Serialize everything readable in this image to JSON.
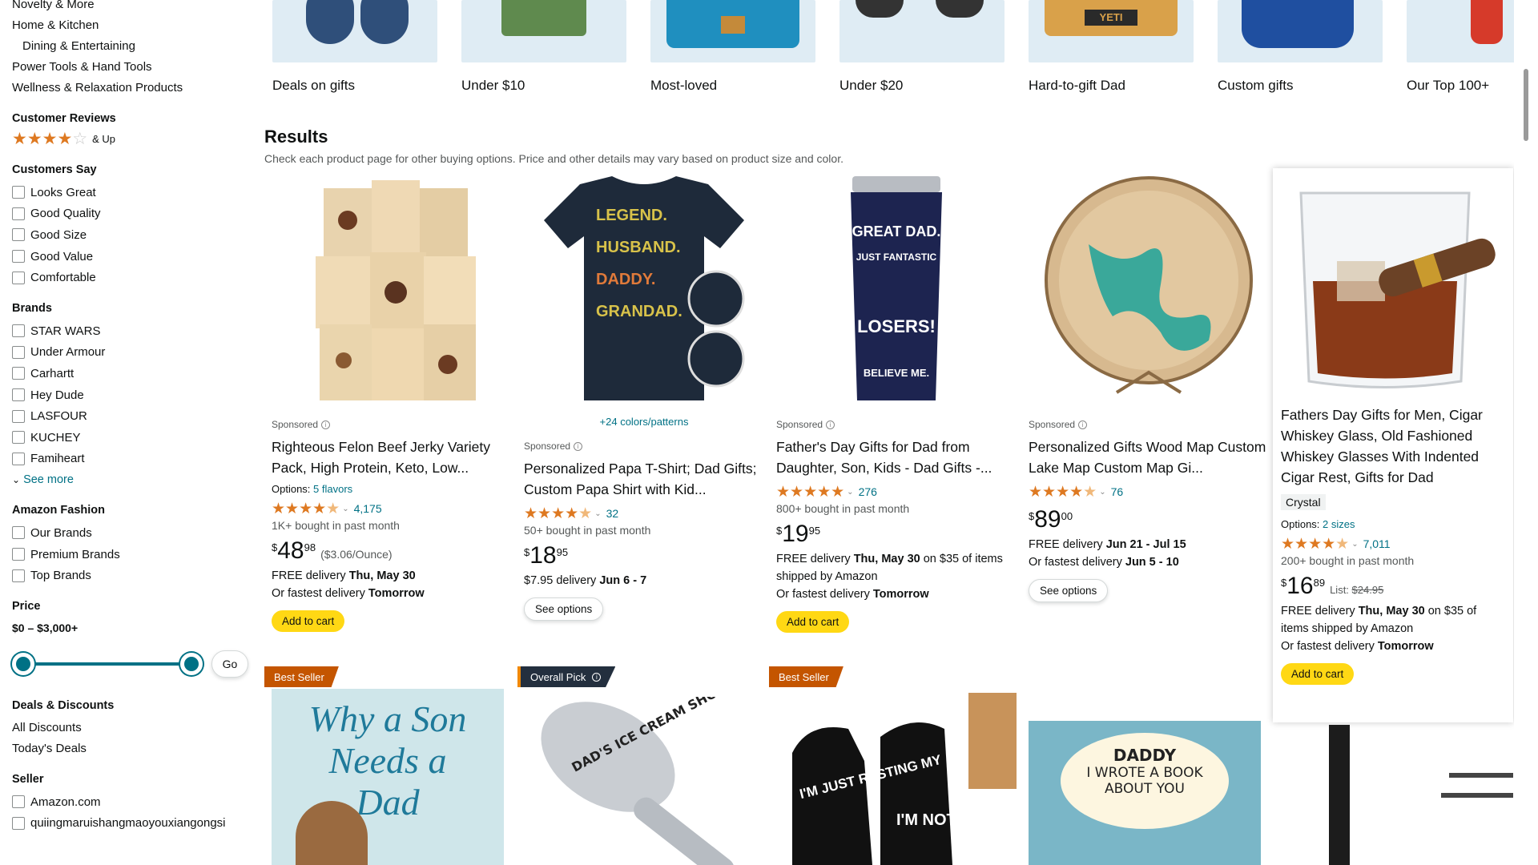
{
  "sidebar": {
    "top_links": [
      "Novelty & More",
      "Home & Kitchen",
      "Dining & Entertaining",
      "Power Tools & Hand Tools",
      "Wellness & Relaxation Products"
    ],
    "customer_reviews": {
      "heading": "Customer Reviews",
      "rating": 4,
      "label": "& Up"
    },
    "customers_say": {
      "heading": "Customers Say",
      "items": [
        "Looks Great",
        "Good Quality",
        "Good Size",
        "Good Value",
        "Comfortable"
      ]
    },
    "brands": {
      "heading": "Brands",
      "items": [
        "STAR WARS",
        "Under Armour",
        "Carhartt",
        "Hey Dude",
        "LASFOUR",
        "KUCHEY",
        "Famiheart"
      ],
      "see_more": "See more"
    },
    "amazon_fashion": {
      "heading": "Amazon Fashion",
      "items": [
        "Our Brands",
        "Premium Brands",
        "Top Brands"
      ]
    },
    "price": {
      "heading": "Price",
      "range": "$0 – $3,000+",
      "go": "Go"
    },
    "deals": {
      "heading": "Deals & Discounts",
      "items": [
        "All Discounts",
        "Today's Deals"
      ]
    },
    "seller": {
      "heading": "Seller",
      "items": [
        "Amazon.com",
        "quiingmaruishangmaoyouxiangongsi"
      ]
    }
  },
  "categories": [
    {
      "label": "Deals on gifts",
      "color": "#dfecf4",
      "thing": "#2f4f7a"
    },
    {
      "label": "Under $10",
      "color": "#dfecf4",
      "thing": "#5f8a4e"
    },
    {
      "label": "Most-loved",
      "color": "#dfecf4",
      "thing": "#1f8fbf"
    },
    {
      "label": "Under $20",
      "color": "#dfecf4",
      "thing": "#333333"
    },
    {
      "label": "Hard-to-gift Dad",
      "color": "#dfecf4",
      "thing": "#d9a14a"
    },
    {
      "label": "Custom gifts",
      "color": "#dfecf4",
      "thing": "#1f4fa0"
    },
    {
      "label": "Our Top 100+",
      "color": "#dfecf4",
      "thing": "#d63a2a"
    }
  ],
  "results": {
    "heading": "Results",
    "subtext": "Check each product page for other buying options. Price and other details may vary based on product size and color."
  },
  "products": [
    {
      "sponsored": "Sponsored",
      "title": "Righteous Felon Beef Jerky Variety Pack, High Protein, Keto, Low...",
      "options_label": "Options:",
      "options_link": "5 flavors",
      "rating": 4.5,
      "reviews": "4,175",
      "bought": "1K+ bought in past month",
      "price_sym": "$",
      "price_whole": "48",
      "price_frac": "98",
      "unit_price": "($3.06/Ounce)",
      "delivery_1_pre": "FREE delivery ",
      "delivery_1_date": "Thu, May 30",
      "delivery_1_post": "",
      "delivery_2_pre": "Or fastest delivery ",
      "delivery_2_date": "Tomorrow",
      "button": "Add to cart"
    },
    {
      "colors": "+24 colors/patterns",
      "sponsored": "Sponsored",
      "title": "Personalized Papa T-Shirt; Dad Gifts; Custom Papa Shirt with Kid...",
      "rating": 4.5,
      "reviews": "32",
      "bought": "50+ bought in past month",
      "price_sym": "$",
      "price_whole": "18",
      "price_frac": "95",
      "delivery_1_pre": "$7.95 delivery ",
      "delivery_1_date": "Jun 6 - 7",
      "button": "See options"
    },
    {
      "sponsored": "Sponsored",
      "title": "Father's Day Gifts for Dad from Daughter, Son, Kids - Dad Gifts -...",
      "rating": 5,
      "reviews": "276",
      "bought": "800+ bought in past month",
      "price_sym": "$",
      "price_whole": "19",
      "price_frac": "95",
      "delivery_1_pre": "FREE delivery ",
      "delivery_1_date": "Thu, May 30",
      "delivery_1_post": " on $35 of items shipped by Amazon",
      "delivery_2_pre": "Or fastest delivery ",
      "delivery_2_date": "Tomorrow",
      "button": "Add to cart"
    },
    {
      "sponsored": "Sponsored",
      "title": "Personalized Gifts Wood Map Custom Lake Map Custom Map Gi...",
      "rating": 4.5,
      "reviews": "76",
      "price_sym": "$",
      "price_whole": "89",
      "price_frac": "00",
      "delivery_1_pre": "FREE delivery ",
      "delivery_1_date": "Jun 21 - Jul 15",
      "delivery_2_pre": "Or fastest delivery ",
      "delivery_2_date": "Jun 5 - 10",
      "button": "See options"
    },
    {
      "title": "Fathers Day Gifts for Men, Cigar Whiskey Glass, Old Fashioned Whiskey Glasses With Indented Cigar Rest, Gifts for Dad",
      "variant": "Crystal",
      "options_label": "Options:",
      "options_link": "2 sizes",
      "rating": 4.5,
      "reviews": "7,011",
      "bought": "200+ bought in past month",
      "price_sym": "$",
      "price_whole": "16",
      "price_frac": "89",
      "list_label": "List:",
      "list_price": "$24.95",
      "delivery_1_pre": "FREE delivery ",
      "delivery_1_date": "Thu, May 30",
      "delivery_1_post": " on $35 of items shipped by Amazon",
      "delivery_2_pre": "Or fastest delivery ",
      "delivery_2_date": "Tomorrow",
      "button": "Add to cart"
    }
  ],
  "row2": {
    "badges": [
      "Best Seller",
      "Overall Pick",
      "Best Seller"
    ],
    "book_title": [
      "Why a Son",
      "Needs a",
      "Dad"
    ],
    "spoon_text": "DAD'S ICE CREAM SHOVEL",
    "socks_text_left": "I'M JUST RESTING MY",
    "socks_text_right": "I'M NOT",
    "book2_title": [
      "DADDY",
      "I WROTE A BOOK",
      "ABOUT YOU"
    ]
  },
  "colors": {
    "star": "#de7921",
    "link": "#007185",
    "cart": "#ffd814",
    "best_seller": "#c45500",
    "overall_pick": "#232f3e"
  }
}
